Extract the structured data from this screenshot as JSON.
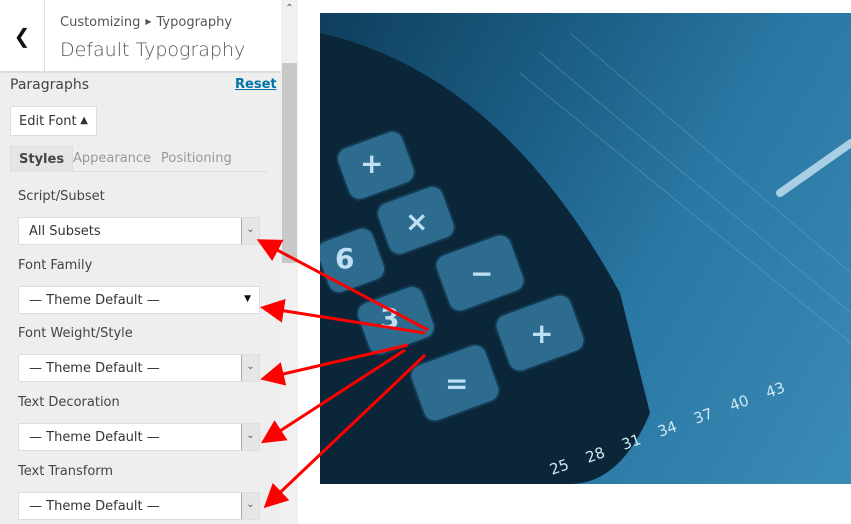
{
  "header": {
    "breadcrumb_parent": "Customizing",
    "breadcrumb_current": "Typography",
    "title": "Default Typography"
  },
  "section": {
    "title": "Paragraphs",
    "reset_label": "Reset",
    "edit_font_label": "Edit Font"
  },
  "tabs": [
    {
      "label": "Styles",
      "active": true
    },
    {
      "label": "Appearance",
      "active": false
    },
    {
      "label": "Positioning",
      "active": false
    }
  ],
  "fields": [
    {
      "label": "Script/Subset",
      "value": "All Subsets"
    },
    {
      "label": "Font Family",
      "value": "— Theme Default —"
    },
    {
      "label": "Font Weight/Style",
      "value": "— Theme Default —"
    },
    {
      "label": "Text Decoration",
      "value": "— Theme Default —"
    },
    {
      "label": "Text Transform",
      "value": "— Theme Default —"
    }
  ],
  "photo": {
    "ruler_numbers": [
      "25",
      "28",
      "31",
      "34",
      "37",
      "40",
      "43"
    ],
    "key_labels": [
      "+",
      "×",
      "6",
      "−",
      "3",
      "+",
      "="
    ]
  },
  "colors": {
    "arrow": "#ff0000",
    "link": "#0073aa",
    "photo_tint": "#1c5f86"
  }
}
